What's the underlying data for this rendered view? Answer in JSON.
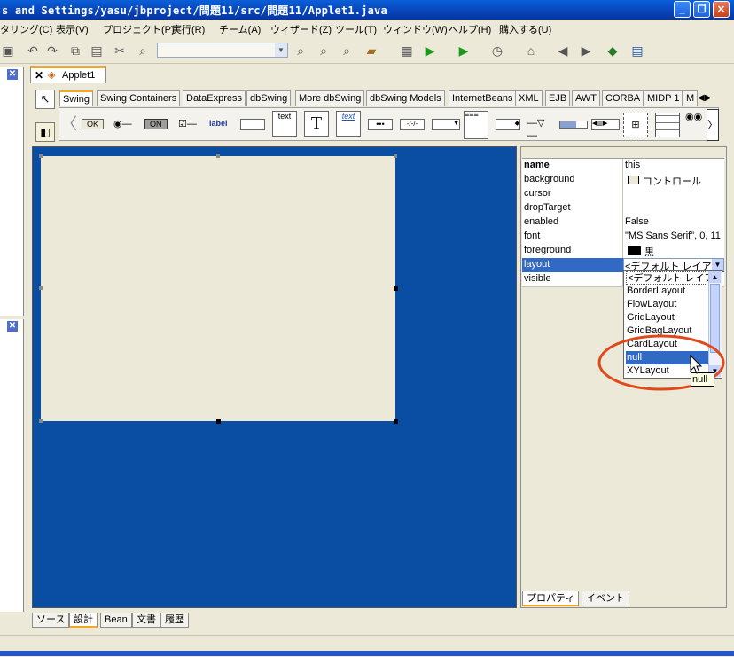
{
  "window": {
    "title": "s and Settings/yasu/jbproject/問題11/src/問題11/Applet1.java",
    "minimize_icon": "minimize-icon",
    "maximize_icon": "restore-icon",
    "close_icon": "close-icon"
  },
  "menu": [
    "タリング(C)",
    "表示(V)",
    "プロジェクト(P)",
    "実行(R)",
    "チーム(A)",
    "ウィザード(Z)",
    "ツール(T)",
    "ウィンドウ(W)",
    "ヘルプ(H)",
    "購入する(U)"
  ],
  "file_tab": {
    "label": "Applet1"
  },
  "palette": {
    "tabs": [
      "Swing",
      "Swing Containers",
      "DataExpress",
      "dbSwing",
      "More dbSwing",
      "dbSwing Models",
      "InternetBeans",
      "XML",
      "EJB",
      "AWT",
      "CORBA",
      "MIDP 1",
      "M"
    ],
    "items": {
      "ok": "OK",
      "on": "ON",
      "label": "label",
      "text": "text",
      "T": "T",
      "text_italic": "text"
    }
  },
  "inspector": {
    "rows": [
      {
        "name": "name",
        "value": "this"
      },
      {
        "name": "background",
        "value": "コントロール"
      },
      {
        "name": "cursor",
        "value": ""
      },
      {
        "name": "dropTarget",
        "value": ""
      },
      {
        "name": "enabled",
        "value": "False"
      },
      {
        "name": "font",
        "value": "\"MS Sans Serif\", 0, 11"
      },
      {
        "name": "foreground",
        "value": "黒"
      },
      {
        "name": "layout",
        "value": "<デフォルト レイア"
      },
      {
        "name": "visible",
        "value": ""
      }
    ],
    "dropdown_items": [
      "<デフォルト レイア",
      "BorderLayout",
      "FlowLayout",
      "GridLayout",
      "GridBagLayout",
      "CardLayout",
      "null",
      "XYLayout"
    ],
    "selected_item": "null",
    "tooltip": "null",
    "bottom_tabs": [
      "プロパティ",
      "イベント"
    ]
  },
  "bottom_tabs": [
    "ソース",
    "設計",
    "Bean",
    "文書",
    "履歴"
  ],
  "colors": {
    "designer_bg": "#0a4ea3",
    "selection": "#316ac5",
    "highlight_circle": "#e04a1a"
  }
}
